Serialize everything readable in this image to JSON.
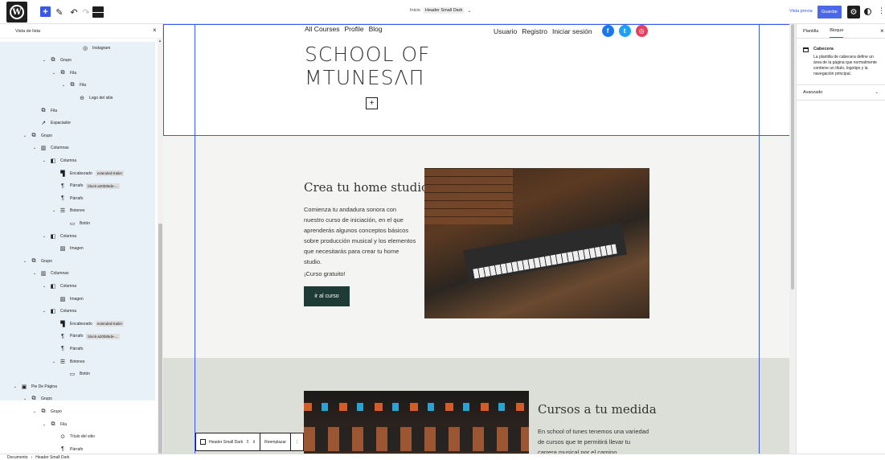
{
  "toolbar": {
    "doc_prefix": "Inicio",
    "doc_template": "Header Small Dark",
    "preview": "Vista previa",
    "save": "Guardar"
  },
  "listview": {
    "title": "Vista de lista",
    "rows": [
      {
        "label": "Instagram",
        "icon": "instagram-icon",
        "glyph": "◎"
      },
      {
        "label": "Grupo",
        "icon": "group-icon",
        "glyph": "⧉",
        "chev": "⌄"
      },
      {
        "label": "Fila",
        "icon": "row-icon",
        "glyph": "⧉",
        "chev": "⌄"
      },
      {
        "label": "Fila",
        "icon": "row-icon",
        "glyph": "⧉",
        "chev": "⌄"
      },
      {
        "label": "Logo del sitio",
        "icon": "site-logo-icon",
        "glyph": "⊖"
      },
      {
        "label": "Fila",
        "icon": "row-icon",
        "glyph": "⧉"
      },
      {
        "label": "Espaciador",
        "icon": "spacer-icon",
        "glyph": "↗"
      },
      {
        "label": "Grupo",
        "icon": "group-icon",
        "glyph": "⧉",
        "chev": "⌄"
      },
      {
        "label": "Columnas",
        "icon": "columns-icon",
        "glyph": "▥",
        "chev": "⌄"
      },
      {
        "label": "Columna",
        "icon": "column-icon",
        "glyph": "◧",
        "chev": "⌄"
      },
      {
        "label": "Encabezado",
        "icon": "heading-icon",
        "glyph": "▜",
        "tag": "extended-trailer"
      },
      {
        "label": "Párrafo",
        "icon": "paragraph-icon",
        "glyph": "¶",
        "tag": "block-a20b85de-..."
      },
      {
        "label": "Párrafo",
        "icon": "paragraph-icon",
        "glyph": "¶"
      },
      {
        "label": "Botones",
        "icon": "buttons-icon",
        "glyph": "☰",
        "chev": "⌄"
      },
      {
        "label": "Botón",
        "icon": "button-icon",
        "glyph": "▭"
      },
      {
        "label": "Columna",
        "icon": "column-icon",
        "glyph": "◧",
        "chev": "⌄"
      },
      {
        "label": "Imagen",
        "icon": "image-icon",
        "glyph": "▨"
      },
      {
        "label": "Grupo",
        "icon": "group-icon",
        "glyph": "⧉",
        "chev": "⌄"
      },
      {
        "label": "Columnas",
        "icon": "columns-icon",
        "glyph": "▥",
        "chev": "⌄"
      },
      {
        "label": "Columna",
        "icon": "column-icon",
        "glyph": "◧",
        "chev": "⌄"
      },
      {
        "label": "Imagen",
        "icon": "image-icon",
        "glyph": "▨"
      },
      {
        "label": "Columna",
        "icon": "column-icon",
        "glyph": "◧",
        "chev": "⌄"
      },
      {
        "label": "Encabezado",
        "icon": "heading-icon",
        "glyph": "▜",
        "tag": "extended-trailer"
      },
      {
        "label": "Párrafo",
        "icon": "paragraph-icon",
        "glyph": "¶",
        "tag": "block-a20b85de-..."
      },
      {
        "label": "Párrafo",
        "icon": "paragraph-icon",
        "glyph": "¶"
      },
      {
        "label": "Botones",
        "icon": "buttons-icon",
        "glyph": "☰",
        "chev": "⌄"
      },
      {
        "label": "Botón",
        "icon": "button-icon",
        "glyph": "▭"
      },
      {
        "label": "Pie De Página",
        "icon": "footer-icon",
        "glyph": "▣",
        "chev": "⌄"
      },
      {
        "label": "Grupo",
        "icon": "group-icon",
        "glyph": "⧉",
        "chev": "⌄"
      },
      {
        "label": "Grupo",
        "icon": "group-icon",
        "glyph": "⧉",
        "chev": "⌄"
      },
      {
        "label": "Fila",
        "icon": "row-icon",
        "glyph": "⧉",
        "chev": "⌄"
      },
      {
        "label": "Título del sitio",
        "icon": "site-title-icon",
        "glyph": "⊙"
      },
      {
        "label": "Párrafo",
        "icon": "paragraph-icon",
        "glyph": "¶"
      }
    ]
  },
  "header": {
    "nav_left": [
      "All Courses",
      "Profile",
      "Blog"
    ],
    "nav_right": [
      "Usuario",
      "Registro",
      "Iniciar sesión"
    ],
    "logo_line1": "SCHOOL OF",
    "logo_line2": "MTUNESΛΠ"
  },
  "section1": {
    "title": "Crea tu home studio",
    "text": "Comienza tu andadura sonora con nuestro curso de iniciación, en el que aprenderás algunos conceptos básicos sobre producción musical y los elementos que necesitarás para crear tu home studio.",
    "free": "¡Curso gratuito!",
    "button": "ir al curso"
  },
  "section2": {
    "title": "Cursos a tu medida",
    "text": "En school of tunes tenemos una variedad de cursos que te permitirá llevar tu carrera musical por el camino"
  },
  "block_toolbar": {
    "name": "Header Small Dark",
    "replace": "Reemplazar"
  },
  "settings": {
    "tab_template": "Plantilla",
    "tab_block": "Bloque",
    "block_name": "Cabecera",
    "block_desc": "La plantilla de cabecera define un área de la página que normalmente contiene un título, logotipo y la navegación principal.",
    "advanced": "Avanzado"
  },
  "breadcrumb": {
    "root": "Documento",
    "sep": "›",
    "current": "Header Small Dark"
  },
  "colors": {
    "accent": "#3858e9",
    "button_dark": "#1f3b36",
    "section2_bg": "#dcdfd8"
  }
}
